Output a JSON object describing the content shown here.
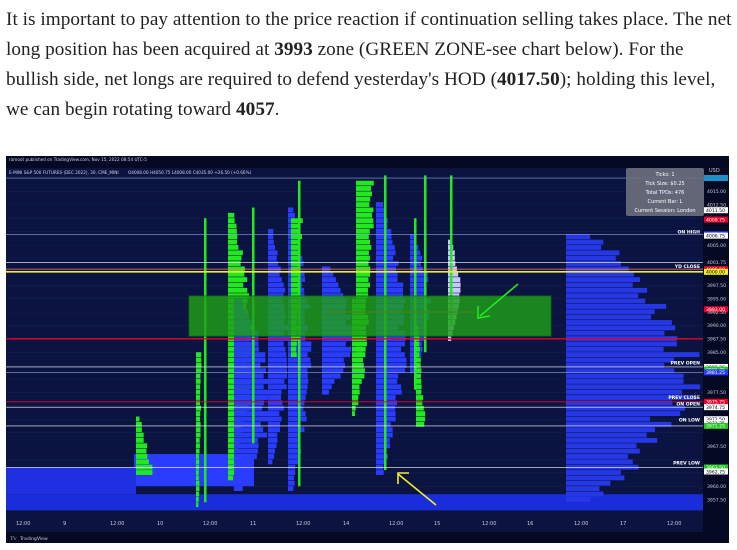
{
  "article": {
    "p1_a": "It is important to pay attention to the price reaction if continuation selling takes place. The net long position has been acquired at ",
    "p1_b": "3993",
    "p1_c": " zone (GREEN ZONE-see chart below). For the bullish side, net longs are required to defend yesterday's HOD (",
    "p1_d": "4017.50",
    "p1_e": "); holding this level, we can begin rotating toward ",
    "p1_f": "4057",
    "p1_g": "."
  },
  "chart": {
    "published": "ramoot published on TradingView.com, Nov 15, 2022 08:54 UTC-5",
    "symbol_line": "E-MINI S&P 500 FUTURES (DEC 2022), 30, CME_MINI",
    "ohlc": "O4008.00  H4050.75  L4008.00  C4035.00  +26.50 (+0.66%)",
    "currency": "USD",
    "tooltip": [
      "Ticks: 1",
      "Tick Size: $0.25",
      "Total TPOs: 476",
      "Current Bar: L",
      "Current Session: London"
    ],
    "price_labels": [
      "4015.00",
      "4012.50",
      "4011.50",
      "4009.75",
      "4007.00",
      "4006.75",
      "4005.00",
      "4001.75",
      "4000.50",
      "4000.00",
      "3997.50",
      "3995.00",
      "3993.00",
      "3992.50",
      "3990.00",
      "3987.50",
      "3985.00",
      "3982.25",
      "3981.75",
      "3981.25",
      "3977.50",
      "3975.75",
      "3974.75",
      "3972.50",
      "3971.75",
      "3971.25",
      "3967.50",
      "3963.50",
      "3962.75",
      "3960.00",
      "3957.50"
    ],
    "level_labels": [
      "ON HIGH",
      "YD CLOSE",
      "PREV OPEN",
      "PREV CLOSE",
      "ON OPEN",
      "ON LOW",
      "PREV LOW"
    ],
    "time_labels": [
      "12:00",
      "9",
      "12:00",
      "10",
      "12:00",
      "11",
      "12:00",
      "14",
      "12:00",
      "15",
      "12:00",
      "16",
      "12:00",
      "17",
      "12:00"
    ],
    "footer": "TradingView"
  },
  "colors": {
    "background": "#0b1440",
    "profile_blue": "#2a3cff",
    "profile_green": "#22e81e",
    "zone_green": "#1ea01a",
    "level_red": "#e8002a",
    "level_yellow": "#f2ee28",
    "arrow_green": "#22e81e",
    "arrow_yellow": "#f2ee28"
  }
}
